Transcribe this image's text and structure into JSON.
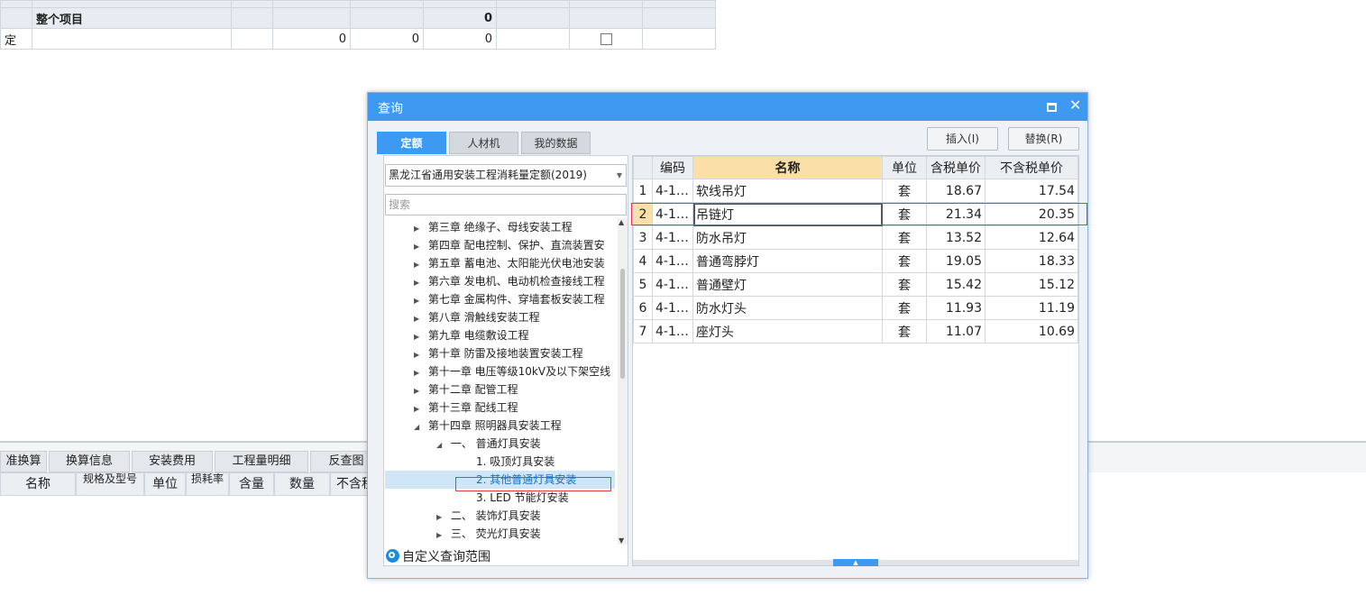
{
  "background": {
    "rows": [
      {
        "type": "",
        "name": "整个项目",
        "amount": "",
        "qty": "",
        "price": "",
        "total": "0"
      },
      {
        "type": "定",
        "name": "",
        "amount": "0",
        "qty": "0",
        "price": "0",
        "total": ""
      }
    ],
    "tabs": [
      "准换算",
      "换算信息",
      "安装费用",
      "工程量明细",
      "反查图"
    ],
    "columns": [
      "名称",
      "规格及型号",
      "单位",
      "损耗率",
      "含量",
      "数量",
      "不含税"
    ]
  },
  "dialog": {
    "title": "查询",
    "tabs": [
      "定额",
      "人材机",
      "我的数据"
    ],
    "insert_label": "插入(I)",
    "replace_label": "替换(R)",
    "quota_library": "黑龙江省通用安装工程消耗量定额(2019)",
    "search_placeholder": "搜索",
    "tree": [
      "第三章 绝缘子、母线安装工程",
      "第四章 配电控制、保护、直流装置安",
      "第五章 蓄电池、太阳能光伏电池安装",
      "第六章 发电机、电动机检查接线工程",
      "第七章 金属构件、穿墙套板安装工程",
      "第八章 滑触线安装工程",
      "第九章 电缆敷设工程",
      "第十章 防雷及接地装置安装工程",
      "第十一章 电压等级10kV及以下架空线",
      "第十二章 配管工程",
      "第十三章 配线工程",
      "第十四章 照明器具安装工程",
      "一、 普通灯具安装",
      "1. 吸顶灯具安装",
      "2. 其他普通灯具安装",
      "3. LED 节能灯安装",
      "二、 装饰灯具安装",
      "三、 荧光灯具安装"
    ],
    "custom_range": "自定义查询范围",
    "grid": {
      "headers": [
        "编码",
        "名称",
        "单位",
        "含税单价",
        "不含税单价"
      ],
      "rows": [
        {
          "no": "1",
          "code": "4-1…",
          "name": "软线吊灯",
          "unit": "套",
          "tax_price": "18.67",
          "notax_price": "17.54"
        },
        {
          "no": "2",
          "code": "4-1…",
          "name": "吊链灯",
          "unit": "套",
          "tax_price": "21.34",
          "notax_price": "20.35"
        },
        {
          "no": "3",
          "code": "4-1…",
          "name": "防水吊灯",
          "unit": "套",
          "tax_price": "13.52",
          "notax_price": "12.64"
        },
        {
          "no": "4",
          "code": "4-1…",
          "name": "普通弯脖灯",
          "unit": "套",
          "tax_price": "19.05",
          "notax_price": "18.33"
        },
        {
          "no": "5",
          "code": "4-1…",
          "name": "普通壁灯",
          "unit": "套",
          "tax_price": "15.42",
          "notax_price": "15.12"
        },
        {
          "no": "6",
          "code": "4-1…",
          "name": "防水灯头",
          "unit": "套",
          "tax_price": "11.93",
          "notax_price": "11.19"
        },
        {
          "no": "7",
          "code": "4-1…",
          "name": "座灯头",
          "unit": "套",
          "tax_price": "11.07",
          "notax_price": "10.69"
        }
      ]
    }
  }
}
